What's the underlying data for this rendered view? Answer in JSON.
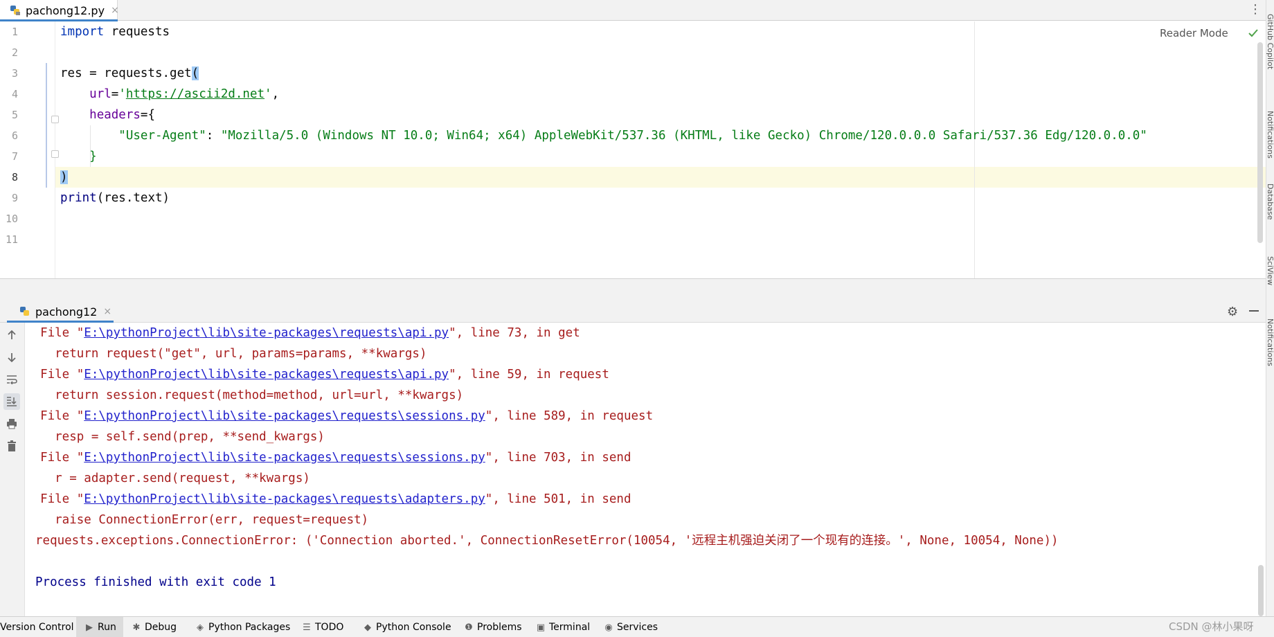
{
  "editor_tab": {
    "filename": "pachong12.py",
    "close": "×"
  },
  "more_menu": "⋮",
  "reader_mode": "Reader Mode",
  "line_numbers": [
    "1",
    "2",
    "3",
    "4",
    "5",
    "6",
    "7",
    "8",
    "9",
    "10",
    "11"
  ],
  "code": {
    "l1_kw": "import",
    "l1_rest": " requests",
    "l3_a": "res = requests.get",
    "l3_paren": "(",
    "l4_indent": "    ",
    "l4_kwarg": "url",
    "l4_eq": "=",
    "l4_q1": "'",
    "l4_url": "https://ascii2d.net",
    "l4_q2": "'",
    "l4_comma": ",",
    "l5_indent": "    ",
    "l5_kwarg": "headers",
    "l5_eq": "=",
    "l5_brace": "{",
    "l6_indent": "        ",
    "l6_key": "\"User-Agent\"",
    "l6_colon": ": ",
    "l6_value": "\"Mozilla/5.0 (Windows NT 10.0; Win64; x64) AppleWebKit/537.36 (KHTML, like Gecko) Chrome/120.0.0.0 Safari/537.36 Edg/120.0.0.0\"",
    "l7_indent": "    ",
    "l7_brace": "}",
    "l8_paren": ")",
    "l10_print": "print",
    "l10_rest": "(res.text)"
  },
  "run_tab": {
    "label": "pachong12",
    "close": "×"
  },
  "console": [
    {
      "pre": "  File \"",
      "path": "E:\\pythonProject\\lib\\site-packages\\requests\\api.py",
      "post": "\", line 73, in get"
    },
    {
      "text": "    return request(\"get\", url, params=params, **kwargs)"
    },
    {
      "pre": "  File \"",
      "path": "E:\\pythonProject\\lib\\site-packages\\requests\\api.py",
      "post": "\", line 59, in request"
    },
    {
      "text": "    return session.request(method=method, url=url, **kwargs)"
    },
    {
      "pre": "  File \"",
      "path": "E:\\pythonProject\\lib\\site-packages\\requests\\sessions.py",
      "post": "\", line 589, in request"
    },
    {
      "text": "    resp = self.send(prep, **send_kwargs)"
    },
    {
      "pre": "  File \"",
      "path": "E:\\pythonProject\\lib\\site-packages\\requests\\sessions.py",
      "post": "\", line 703, in send"
    },
    {
      "text": "    r = adapter.send(request, **kwargs)"
    },
    {
      "pre": "  File \"",
      "path": "E:\\pythonProject\\lib\\site-packages\\requests\\adapters.py",
      "post": "\", line 501, in send"
    },
    {
      "text": "    raise ConnectionError(err, request=request)"
    },
    {
      "text": "requests.exceptions.ConnectionError: ('Connection aborted.', ConnectionResetError(10054, '远程主机强迫关闭了一个现有的连接。', None, 10054, None))"
    },
    {
      "text": ""
    },
    {
      "text": "Process finished with exit code 1"
    }
  ],
  "bottom_bar": {
    "version_control": "Version Control",
    "run": "Run",
    "debug": "Debug",
    "python_packages": "Python Packages",
    "todo": "TODO",
    "python_console": "Python Console",
    "problems": "Problems",
    "terminal": "Terminal",
    "services": "Services"
  },
  "watermark": "CSDN @林小果呀",
  "right_stripe": [
    "GitHub Copilot",
    "Notifications",
    "Database",
    "SciView",
    "Notifications"
  ],
  "colors": {
    "keyword": "#0033b3",
    "string": "#067d17",
    "kwarg": "#660099",
    "error_text": "#a71d1d",
    "link": "#2222cc",
    "exit_text": "#00008b",
    "accent": "#4083c9",
    "current_line": "#fcfae1"
  }
}
